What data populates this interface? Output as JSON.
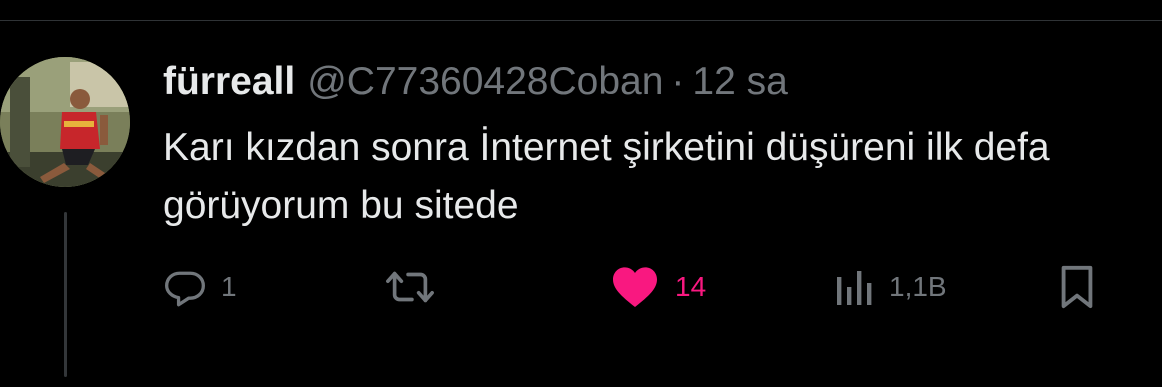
{
  "tweet": {
    "author": {
      "display_name": "fürreall",
      "handle": "@C77360428Coban",
      "avatar_icon": "profile-photo-person-in-red-jersey"
    },
    "separator": "·",
    "timestamp": "12 sa",
    "text": "Karı kızdan sonra İnternet şirketini düşüreni ilk defa görüyorum bu sitede",
    "actions": {
      "reply": {
        "icon": "reply-icon",
        "count": "1"
      },
      "retweet": {
        "icon": "retweet-icon",
        "count": ""
      },
      "like": {
        "icon": "heart-icon",
        "count": "14",
        "liked": true,
        "color": "#f91880"
      },
      "views": {
        "icon": "views-bar-chart-icon",
        "count": "1,1B"
      },
      "bookmark": {
        "icon": "bookmark-icon"
      }
    }
  },
  "colors": {
    "background": "#000000",
    "primary_text": "#e7e9ea",
    "secondary_text": "#71767b",
    "like_pink": "#f91880",
    "divider": "#2f3336"
  }
}
